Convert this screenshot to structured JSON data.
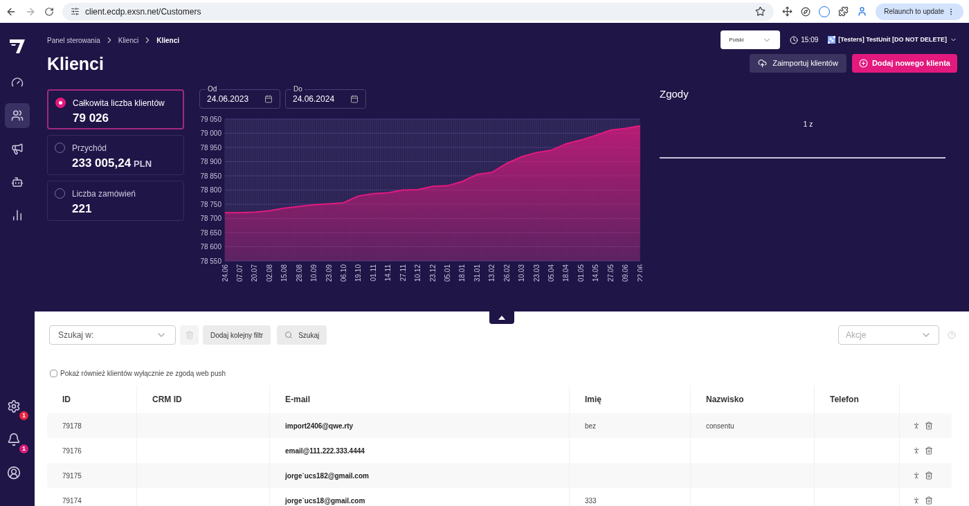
{
  "browser": {
    "url": "client.ecdp.exsn.net/Customers",
    "relaunch": "Relaunch to update"
  },
  "sidebar": {
    "items": [
      {
        "kind": "dashboard",
        "selected": false
      },
      {
        "kind": "customers",
        "selected": true
      },
      {
        "kind": "campaigns",
        "selected": false
      },
      {
        "kind": "automation",
        "selected": false
      },
      {
        "kind": "reports",
        "selected": false
      }
    ],
    "bottom": [
      {
        "kind": "settings",
        "badge": "1",
        "color": "#e8213f"
      },
      {
        "kind": "notifications",
        "badge": "1",
        "color": "#d81b7a"
      },
      {
        "kind": "profile"
      }
    ]
  },
  "breadcrumbs": [
    {
      "label": "Panel sterowania",
      "current": false
    },
    {
      "label": "Klienci",
      "current": false
    },
    {
      "label": "Klienci",
      "current": true
    }
  ],
  "title": "Klienci",
  "language": "Polski",
  "time": "15:09",
  "account": "[Testers] TestUnit [DO NOT DELETE]",
  "actions": [
    {
      "kind": "import",
      "label": "Zaimportuj klientów"
    },
    {
      "kind": "add",
      "label": "Dodaj nowego klienta"
    }
  ],
  "stats": [
    {
      "label": "Całkowita liczba klientów",
      "value": "79 026",
      "selected": true
    },
    {
      "label": "Przychód",
      "value": "233 005,24",
      "unit": "PLN",
      "selected": false
    },
    {
      "label": "Liczba zamówień",
      "value": "221",
      "selected": false
    }
  ],
  "date_range": [
    {
      "label": "Od",
      "value": "24.06.2023"
    },
    {
      "label": "Do",
      "value": "24.06.2024"
    }
  ],
  "chart_data": {
    "type": "area",
    "grid": true,
    "categories": [
      "24.06",
      "07.07",
      "20.07",
      "02.08",
      "15.08",
      "28.08",
      "10.09",
      "23.09",
      "06.10",
      "19.10",
      "01.11",
      "14.11",
      "27.11",
      "10.12",
      "23.12",
      "05.01",
      "18.01",
      "31.01",
      "13.02",
      "26.02",
      "10.03",
      "23.03",
      "05.04",
      "18.04",
      "01.05",
      "14.05",
      "27.05",
      "09.06",
      "22.06"
    ],
    "series": [
      {
        "color": "#e3197e",
        "values": [
          78720,
          78720,
          78722,
          78727,
          78736,
          78742,
          78748,
          78751,
          78755,
          78779,
          78787,
          78790,
          78800,
          78801,
          78813,
          78815,
          78830,
          78855,
          78862,
          78894,
          78917,
          78932,
          78940,
          78963,
          78976,
          78993,
          79011,
          79017,
          79026
        ]
      }
    ],
    "ylim": [
      78550,
      79050
    ],
    "yticks": [
      {
        "value": 78550,
        "label": "78 550"
      },
      {
        "value": 78600,
        "label": "78 600"
      },
      {
        "value": 78650,
        "label": "78 650"
      },
      {
        "value": 78700,
        "label": "78 700"
      },
      {
        "value": 78750,
        "label": "78 750"
      },
      {
        "value": 78800,
        "label": "78 800"
      },
      {
        "value": 78850,
        "label": "78 850"
      },
      {
        "value": 78900,
        "label": "78 900"
      },
      {
        "value": 78950,
        "label": "78 950"
      },
      {
        "value": 79000,
        "label": "79 000"
      },
      {
        "value": 79050,
        "label": "79 050"
      }
    ]
  },
  "consents": {
    "title": "Zgody",
    "caption": "1 z"
  },
  "filters": {
    "search_in": "Szukaj w:",
    "add_filter": "Dodaj kolejny filtr",
    "search": "Szukaj",
    "actions": "Akcje",
    "trash_disabled": true
  },
  "webpush": {
    "label": "Pokaż również klientów wyłącznie ze zgodą web push",
    "checked": false
  },
  "table": {
    "columns": [
      "ID",
      "CRM ID",
      "E-mail",
      "Imię",
      "Nazwisko",
      "Telefon"
    ],
    "rows": [
      {
        "id": "79178",
        "email": "import2406@qwe.rty",
        "first_name": "bez",
        "last_name": "consentu"
      },
      {
        "id": "79176",
        "email": "email@111.222.333.4444"
      },
      {
        "id": "79175",
        "email": "jorge`ucs182@gmail.com"
      },
      {
        "id": "79174",
        "email": "jorge`ucs18@gmail.com",
        "first_name": "333"
      }
    ]
  }
}
